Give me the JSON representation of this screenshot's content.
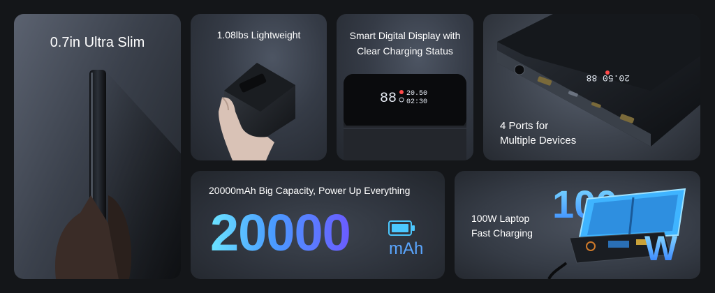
{
  "panels": {
    "slim": {
      "caption": "0.7in Ultra Slim"
    },
    "weight": {
      "caption": "1.08lbs Lightweight"
    },
    "display": {
      "caption_line1": "Smart Digital Display with",
      "caption_line2": "Clear Charging Status",
      "screen_percent": "88",
      "screen_row1": "20.50",
      "screen_row2": "02:30"
    },
    "ports": {
      "caption_line1": "4 Ports for",
      "caption_line2": "Multiple Devices"
    },
    "capacity": {
      "caption": "20000mAh Big Capacity, Power Up Everything",
      "number": "20000",
      "unit": "mAh"
    },
    "laptop": {
      "caption_line1": "100W Laptop",
      "caption_line2": "Fast Charging",
      "big_number": "100",
      "big_unit": "W"
    }
  },
  "icons": [
    "battery-icon",
    "power-bank-image",
    "hand-image",
    "usb-port-icon",
    "charging-cable-image"
  ],
  "colors": {
    "background": "#141619",
    "accent_blue": "#4a9bff",
    "accent_cyan": "#6be3ff",
    "display_red": "#ff4a4a"
  }
}
